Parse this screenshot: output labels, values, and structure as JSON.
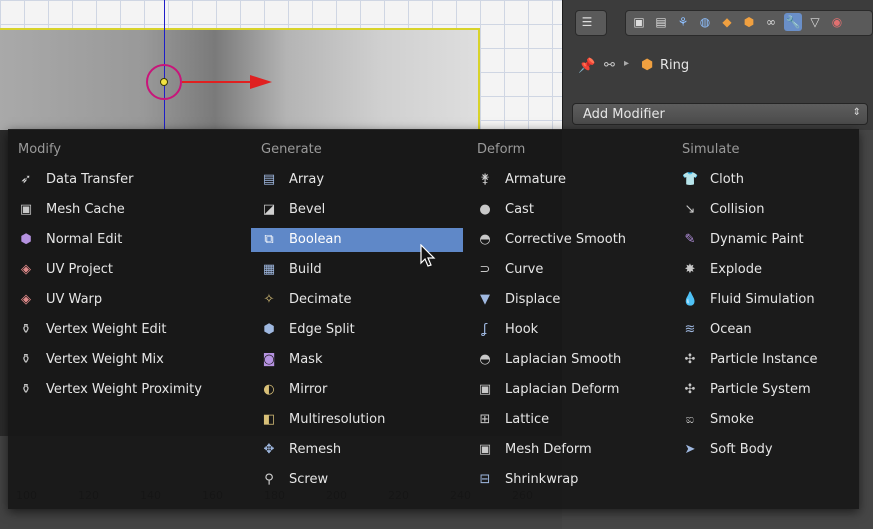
{
  "object": {
    "name": "Ring"
  },
  "add_modifier": {
    "label": "Add Modifier"
  },
  "timeline": {
    "ticks": [
      "100",
      "120",
      "140",
      "160",
      "180",
      "200",
      "220",
      "240",
      "260"
    ]
  },
  "menu": {
    "columns": [
      {
        "header": "Modify",
        "items": [
          {
            "label": "Data Transfer",
            "icon": "data-transfer-icon",
            "glyph": "➶",
            "color": "#d8d8d8"
          },
          {
            "label": "Mesh Cache",
            "icon": "mesh-cache-icon",
            "glyph": "▣",
            "color": "#c8c8c8"
          },
          {
            "label": "Normal Edit",
            "icon": "normal-edit-icon",
            "glyph": "⬢",
            "color": "#b592e0"
          },
          {
            "label": "UV Project",
            "icon": "uv-project-icon",
            "glyph": "◈",
            "color": "#e08a8a"
          },
          {
            "label": "UV Warp",
            "icon": "uv-warp-icon",
            "glyph": "◈",
            "color": "#e08a8a"
          },
          {
            "label": "Vertex Weight Edit",
            "icon": "vertex-weight-edit-icon",
            "glyph": "⚱",
            "color": "#c8c8c8"
          },
          {
            "label": "Vertex Weight Mix",
            "icon": "vertex-weight-mix-icon",
            "glyph": "⚱",
            "color": "#c8c8c8"
          },
          {
            "label": "Vertex Weight Proximity",
            "icon": "vertex-weight-proximity-icon",
            "glyph": "⚱",
            "color": "#c8c8c8"
          }
        ]
      },
      {
        "header": "Generate",
        "items": [
          {
            "label": "Array",
            "icon": "array-icon",
            "glyph": "▤",
            "color": "#9fb8e0"
          },
          {
            "label": "Bevel",
            "icon": "bevel-icon",
            "glyph": "◪",
            "color": "#d0d0d0"
          },
          {
            "label": "Boolean",
            "icon": "boolean-icon",
            "glyph": "⧉",
            "color": "#ffffff"
          },
          {
            "label": "Build",
            "icon": "build-icon",
            "glyph": "▦",
            "color": "#9fb8e0"
          },
          {
            "label": "Decimate",
            "icon": "decimate-icon",
            "glyph": "✧",
            "color": "#d8c078"
          },
          {
            "label": "Edge Split",
            "icon": "edge-split-icon",
            "glyph": "⬢",
            "color": "#9fb8e0"
          },
          {
            "label": "Mask",
            "icon": "mask-icon",
            "glyph": "◙",
            "color": "#b592e0"
          },
          {
            "label": "Mirror",
            "icon": "mirror-icon",
            "glyph": "◐",
            "color": "#d8c078"
          },
          {
            "label": "Multiresolution",
            "icon": "multiresolution-icon",
            "glyph": "◧",
            "color": "#d8c078"
          },
          {
            "label": "Remesh",
            "icon": "remesh-icon",
            "glyph": "✥",
            "color": "#9fb8e0"
          },
          {
            "label": "Screw",
            "icon": "screw-icon",
            "glyph": "⚲",
            "color": "#d0d0d0"
          }
        ]
      },
      {
        "header": "Deform",
        "items": [
          {
            "label": "Armature",
            "icon": "armature-icon",
            "glyph": "⚵",
            "color": "#d0d0d0"
          },
          {
            "label": "Cast",
            "icon": "cast-icon",
            "glyph": "●",
            "color": "#c8c8c8"
          },
          {
            "label": "Corrective Smooth",
            "icon": "corrective-smooth-icon",
            "glyph": "◓",
            "color": "#c8c8c8"
          },
          {
            "label": "Curve",
            "icon": "curve-icon",
            "glyph": "⊃",
            "color": "#c8c8c8"
          },
          {
            "label": "Displace",
            "icon": "displace-icon",
            "glyph": "▼",
            "color": "#9fb8e0"
          },
          {
            "label": "Hook",
            "icon": "hook-icon",
            "glyph": "ʆ",
            "color": "#9fb8e0"
          },
          {
            "label": "Laplacian Smooth",
            "icon": "laplacian-smooth-icon",
            "glyph": "◓",
            "color": "#c8c8c8"
          },
          {
            "label": "Laplacian Deform",
            "icon": "laplacian-deform-icon",
            "glyph": "▣",
            "color": "#c8c8c8"
          },
          {
            "label": "Lattice",
            "icon": "lattice-icon",
            "glyph": "⊞",
            "color": "#c8c8c8"
          },
          {
            "label": "Mesh Deform",
            "icon": "mesh-deform-icon",
            "glyph": "▣",
            "color": "#c8c8c8"
          },
          {
            "label": "Shrinkwrap",
            "icon": "shrinkwrap-icon",
            "glyph": "⊟",
            "color": "#9fb8e0"
          }
        ]
      },
      {
        "header": "Simulate",
        "items": [
          {
            "label": "Cloth",
            "icon": "cloth-icon",
            "glyph": "👕",
            "color": "#c8c8c8"
          },
          {
            "label": "Collision",
            "icon": "collision-icon",
            "glyph": "↘",
            "color": "#c8c8c8"
          },
          {
            "label": "Dynamic Paint",
            "icon": "dynamic-paint-icon",
            "glyph": "✎",
            "color": "#b592e0"
          },
          {
            "label": "Explode",
            "icon": "explode-icon",
            "glyph": "✸",
            "color": "#c8c8c8"
          },
          {
            "label": "Fluid Simulation",
            "icon": "fluid-simulation-icon",
            "glyph": "💧",
            "color": "#7ab0f0"
          },
          {
            "label": "Ocean",
            "icon": "ocean-icon",
            "glyph": "≋",
            "color": "#9fb8e0"
          },
          {
            "label": "Particle Instance",
            "icon": "particle-instance-icon",
            "glyph": "✣",
            "color": "#c8c8c8"
          },
          {
            "label": "Particle System",
            "icon": "particle-system-icon",
            "glyph": "✣",
            "color": "#c8c8c8"
          },
          {
            "label": "Smoke",
            "icon": "smoke-icon",
            "glyph": "ಐ",
            "color": "#c8c8c8"
          },
          {
            "label": "Soft Body",
            "icon": "soft-body-icon",
            "glyph": "➤",
            "color": "#9fb8e0"
          }
        ]
      }
    ]
  }
}
